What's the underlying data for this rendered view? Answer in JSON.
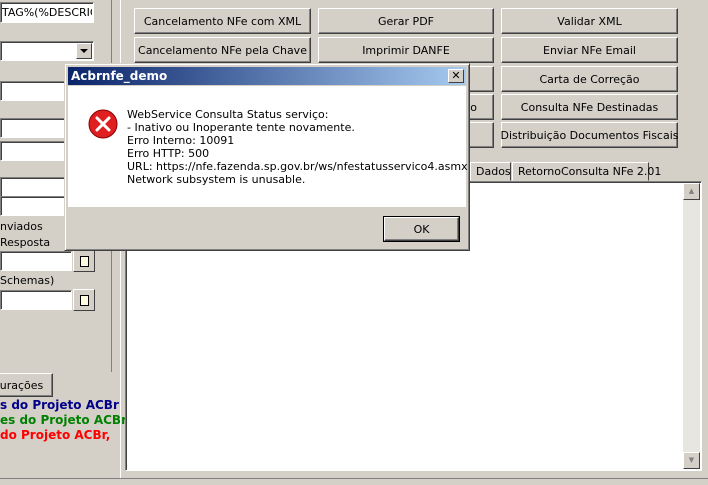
{
  "left_panel": {
    "top_field_value": "TAG%(%DESCRICA",
    "checkbox_1_label": "nviados",
    "checkbox_2_label": "Resposta",
    "schemas_label": "Schemas)",
    "config_button": "urações",
    "credit_lines": [
      {
        "text": "s do Projeto ACBr",
        "color": "#00008b"
      },
      {
        "text": "es do Projeto ACBr",
        "color": "#008000"
      },
      {
        "text": " do Projeto ACBr,",
        "color": "#ff0000"
      },
      {
        "text": "",
        "color": "#ff0000"
      }
    ]
  },
  "buttons": {
    "row1": [
      "Cancelamento NFe com XML",
      "Gerar PDF",
      "Validar XML"
    ],
    "row2": [
      "Cancelamento NFe pela Chave",
      "Imprimir DANFE",
      "Enviar NFe Email"
    ],
    "row3_right": "Carta de Correção",
    "row4_mid_tail": "o",
    "row4_right": "Consulta NFe Destinadas",
    "row5_right": "Distribuição Documentos Fiscais"
  },
  "tabs": [
    "Dados",
    "RetornoConsulta NFe 2.01"
  ],
  "dialog": {
    "title": "Acbrnfe_demo",
    "close_glyph": "✕",
    "message_lines": [
      "WebService Consulta Status serviço:",
      "- Inativo ou Inoperante tente novamente.",
      "Erro Interno: 10091",
      "Erro HTTP: 500",
      "URL: https://nfe.fazenda.sp.gov.br/ws/nfestatusservico4.asmx",
      "Network subsystem is unusable."
    ],
    "ok_label": "OK",
    "icon": "error-icon"
  },
  "scrollbar": {
    "up_glyph": "▲",
    "down_glyph": "▼"
  },
  "colors": {
    "titlebar_start": "#0a246a",
    "titlebar_end": "#a6caf0",
    "error_red": "#e02020"
  }
}
